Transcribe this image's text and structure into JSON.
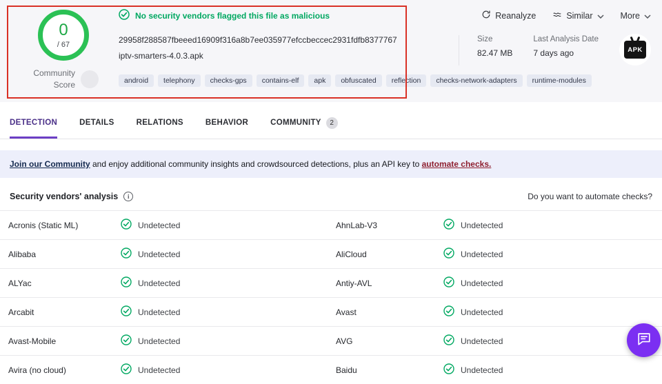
{
  "colors": {
    "ring_green": "#2BC155",
    "status_green": "#00A861",
    "tab_active_purple": "#6C3FC5",
    "annotation_red": "#D93025",
    "chat_purple": "#7B2FF2",
    "banner_bg": "#EDEFFB"
  },
  "header": {
    "score": {
      "value": "0",
      "total": "/ 67",
      "label": "Community Score"
    },
    "alert_message": "No security vendors flagged this file as malicious",
    "file_hash": "29958f288587fbeeed16909f316a8b7ee035977efccbeccec2931fdfb8377767",
    "file_name": "iptv-smarters-4.0.3.apk",
    "tags": [
      "android",
      "telephony",
      "checks-gps",
      "contains-elf",
      "apk",
      "obfuscated",
      "reflection",
      "checks-network-adapters",
      "runtime-modules"
    ],
    "meta": {
      "size_label": "Size",
      "size_value": "82.47 MB",
      "date_label": "Last Analysis Date",
      "date_value": "7 days ago",
      "file_type": "APK"
    },
    "actions": {
      "reanalyze": "Reanalyze",
      "similar": "Similar",
      "more": "More"
    }
  },
  "tabs": [
    {
      "label": "DETECTION"
    },
    {
      "label": "DETAILS"
    },
    {
      "label": "RELATIONS"
    },
    {
      "label": "BEHAVIOR"
    },
    {
      "label": "COMMUNITY",
      "badge": "2"
    }
  ],
  "banner": {
    "link1": "Join our Community",
    "middle": " and enjoy additional community insights and crowdsourced detections, plus an API key to ",
    "link2": "automate checks."
  },
  "analysis": {
    "title": "Security vendors' analysis",
    "automate_prompt": "Do you want to automate checks?"
  },
  "vendors": {
    "rows": [
      {
        "left_name": "Acronis (Static ML)",
        "left_status": "Undetected",
        "right_name": "AhnLab-V3",
        "right_status": "Undetected"
      },
      {
        "left_name": "Alibaba",
        "left_status": "Undetected",
        "right_name": "AliCloud",
        "right_status": "Undetected"
      },
      {
        "left_name": "ALYac",
        "left_status": "Undetected",
        "right_name": "Antiy-AVL",
        "right_status": "Undetected"
      },
      {
        "left_name": "Arcabit",
        "left_status": "Undetected",
        "right_name": "Avast",
        "right_status": "Undetected"
      },
      {
        "left_name": "Avast-Mobile",
        "left_status": "Undetected",
        "right_name": "AVG",
        "right_status": "Undetected"
      },
      {
        "left_name": "Avira (no cloud)",
        "left_status": "Undetected",
        "right_name": "Baidu",
        "right_status": "Undetected"
      }
    ]
  }
}
